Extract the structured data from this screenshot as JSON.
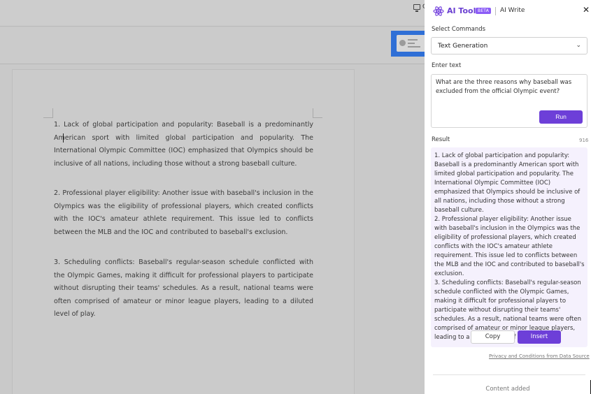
{
  "window": {
    "screen_label": "C"
  },
  "document": {
    "paragraphs": [
      "1. Lack of global participation and popularity: Baseball is a predominantly American sport with limited global participation and popularity. The International Olympic Committee (IOC) emphasized that Olympics should be inclusive of all nations, including those without a strong baseball culture.",
      "2. Professional player eligibility: Another issue with baseball's inclusion in the Olympics was the eligibility of professional players, which created conflicts with the IOC's amateur athlete requirement. This issue led to conflicts between the MLB and the IOC and contributed to baseball's exclusion.",
      "3. Scheduling conflicts: Baseball's regular-season schedule conflicted with the Olympic Games, making it difficult for professional players to participate without disrupting their teams' schedules. As a result, national teams were often comprised of amateur or minor league players, leading to a diluted level of play."
    ]
  },
  "panel": {
    "title": "AI Tools",
    "beta_badge": "BETA",
    "mode": "AI Write",
    "icons": {
      "logo": "atom-icon",
      "close": "close-icon",
      "dropdown": "chevron-down-icon"
    },
    "colors": {
      "accent": "#6d3fd8",
      "result_bg": "#f5f1fd"
    },
    "select_commands": {
      "label": "Select Commands",
      "value": "Text Generation"
    },
    "enter_text": {
      "label": "Enter text",
      "value": "What are the three reasons why baseball was excluded from the official Olympic event?"
    },
    "run_label": "Run",
    "result": {
      "label": "Result",
      "count": "916",
      "text": "1. Lack of global participation and popularity: Baseball is a predominantly American sport with limited global participation and popularity. The International Olympic Committee (IOC) emphasized that Olympics should be inclusive of all nations, including those without a strong baseball culture.\n2. Professional player eligibility: Another issue with baseball's inclusion in the Olympics was the eligibility of professional players, which created conflicts with the IOC's amateur athlete requirement. This issue led to conflicts between the MLB and the IOC and contributed to baseball's exclusion.\n3. Scheduling conflicts: Baseball's regular-season schedule conflicted with the Olympic Games, making it difficult for professional players to participate without disrupting their teams' schedules. As a result, national teams were often comprised of amateur or minor league players, leading to a diluted level of play."
    },
    "copy_label": "Copy",
    "insert_label": "Insert",
    "privacy_link": "Privacy and Conditions from Data Source",
    "status": "Content added"
  }
}
